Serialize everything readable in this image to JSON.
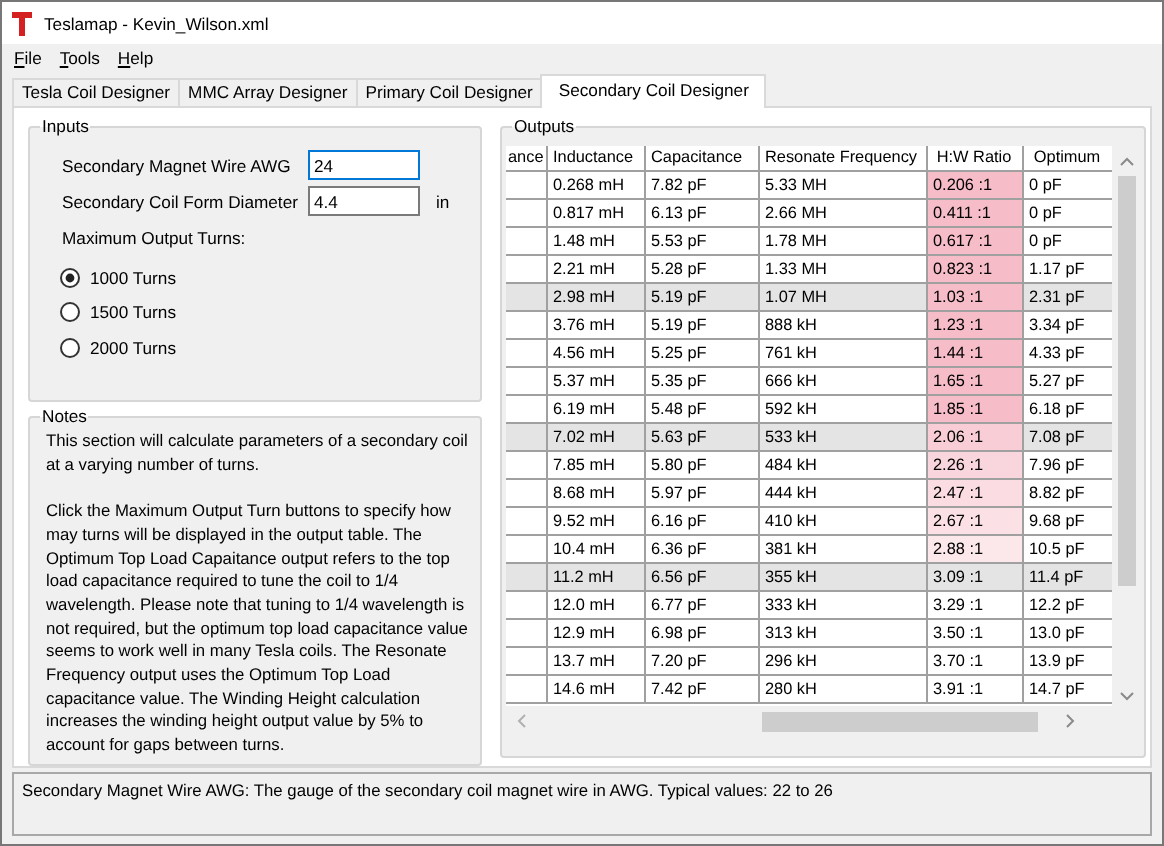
{
  "window": {
    "title": "Teslamap - Kevin_Wilson.xml"
  },
  "menu": [
    {
      "label": "File"
    },
    {
      "label": "Tools"
    },
    {
      "label": "Help"
    }
  ],
  "tabs": [
    {
      "label": "Tesla Coil Designer",
      "selected": false
    },
    {
      "label": "MMC Array Designer",
      "selected": false
    },
    {
      "label": "Primary Coil Designer",
      "selected": false
    },
    {
      "label": "Secondary Coil Designer",
      "selected": true
    }
  ],
  "inputs": {
    "title": "Inputs",
    "fields": [
      {
        "label": "Secondary Magnet Wire AWG",
        "value": "24",
        "focused": true
      },
      {
        "label": "Secondary Coil Form Diameter",
        "value": "4.4",
        "unit": "in",
        "focused": false
      }
    ],
    "turns_label": "Maximum Output Turns:",
    "turns": [
      {
        "label": "1000 Turns",
        "selected": true
      },
      {
        "label": "1500 Turns",
        "selected": false
      },
      {
        "label": "2000 Turns",
        "selected": false
      }
    ]
  },
  "notes": {
    "title": "Notes",
    "paragraphs": [
      "This section will calculate parameters of a secondary coil at a varying number of turns.",
      "Click the Maximum Output Turn buttons to specify how may turns will be displayed in the output table. The Optimum Top Load Capaitance output refers to the top load capacitance required to tune the coil to 1/4 wavelength. Please note that tuning to 1/4 wavelength is not required, but the optimum top load capacitance value seems to work well in many Tesla coils. The Resonate Frequency output uses the Optimum Top Load capacitance value. The Winding Height calculation increases the winding height output value by 5% to account for gaps between turns."
    ]
  },
  "outputs": {
    "title": "Outputs",
    "columns": [
      "ance",
      "Inductance",
      "Capacitance",
      "Resonate Frequency",
      "H:W Ratio",
      "Optimum"
    ],
    "rows": [
      {
        "cells": [
          "",
          "0.268 mH",
          "7.82 pF",
          "5.33 MH",
          "0.206 :1",
          "0 pF"
        ],
        "shaded": false,
        "color": "#f6bcc8"
      },
      {
        "cells": [
          "",
          "0.817 mH",
          "6.13 pF",
          "2.66 MH",
          "0.411 :1",
          "0 pF"
        ],
        "shaded": false,
        "color": "#f6bcc8"
      },
      {
        "cells": [
          "",
          "1.48 mH",
          "5.53 pF",
          "1.78 MH",
          "0.617 :1",
          "0 pF"
        ],
        "shaded": false,
        "color": "#f6bcc8"
      },
      {
        "cells": [
          "",
          "2.21 mH",
          "5.28 pF",
          "1.33 MH",
          "0.823 :1",
          "1.17 pF"
        ],
        "shaded": false,
        "color": "#f6bcc8"
      },
      {
        "cells": [
          "",
          "2.98 mH",
          "5.19 pF",
          "1.07 MH",
          "1.03 :1",
          "2.31 pF"
        ],
        "shaded": true,
        "color": "#f6bcc8"
      },
      {
        "cells": [
          "",
          "3.76 mH",
          "5.19 pF",
          "888 kH",
          "1.23 :1",
          "3.34 pF"
        ],
        "shaded": false,
        "color": "#f6bcc8"
      },
      {
        "cells": [
          "",
          "4.56 mH",
          "5.25 pF",
          "761 kH",
          "1.44 :1",
          "4.33 pF"
        ],
        "shaded": false,
        "color": "#f6bcc8"
      },
      {
        "cells": [
          "",
          "5.37 mH",
          "5.35 pF",
          "666 kH",
          "1.65 :1",
          "5.27 pF"
        ],
        "shaded": false,
        "color": "#f6bcc8"
      },
      {
        "cells": [
          "",
          "6.19 mH",
          "5.48 pF",
          "592 kH",
          "1.85 :1",
          "6.18 pF"
        ],
        "shaded": false,
        "color": "#f6bcc8"
      },
      {
        "cells": [
          "",
          "7.02 mH",
          "5.63 pF",
          "533 kH",
          "2.06 :1",
          "7.08 pF"
        ],
        "shaded": true,
        "color": "#f8cdd6"
      },
      {
        "cells": [
          "",
          "7.85 mH",
          "5.80 pF",
          "484 kH",
          "2.26 :1",
          "7.96 pF"
        ],
        "shaded": false,
        "color": "#f9d6dd"
      },
      {
        "cells": [
          "",
          "8.68 mH",
          "5.97 pF",
          "444 kH",
          "2.47 :1",
          "8.82 pF"
        ],
        "shaded": false,
        "color": "#fadce2"
      },
      {
        "cells": [
          "",
          "9.52 mH",
          "6.16 pF",
          "410 kH",
          "2.67 :1",
          "9.68 pF"
        ],
        "shaded": false,
        "color": "#fbe1e6"
      },
      {
        "cells": [
          "",
          "10.4 mH",
          "6.36 pF",
          "381 kH",
          "2.88 :1",
          "10.5 pF"
        ],
        "shaded": false,
        "color": "#fce7eb"
      },
      {
        "cells": [
          "",
          "11.2 mH",
          "6.56 pF",
          "355 kH",
          "3.09 :1",
          "11.4 pF"
        ],
        "shaded": true
      },
      {
        "cells": [
          "",
          "12.0 mH",
          "6.77 pF",
          "333 kH",
          "3.29 :1",
          "12.2 pF"
        ],
        "shaded": false
      },
      {
        "cells": [
          "",
          "12.9 mH",
          "6.98 pF",
          "313 kH",
          "3.50 :1",
          "13.0 pF"
        ],
        "shaded": false
      },
      {
        "cells": [
          "",
          "13.7 mH",
          "7.20 pF",
          "296 kH",
          "3.70 :1",
          "13.9 pF"
        ],
        "shaded": false
      },
      {
        "cells": [
          "",
          "14.6 mH",
          "7.42 pF",
          "280 kH",
          "3.91 :1",
          "14.7 pF"
        ],
        "shaded": false
      }
    ]
  },
  "status_bar": "Secondary Magnet Wire AWG: The gauge of the secondary coil magnet wire in AWG. Typical values: 22 to 26"
}
